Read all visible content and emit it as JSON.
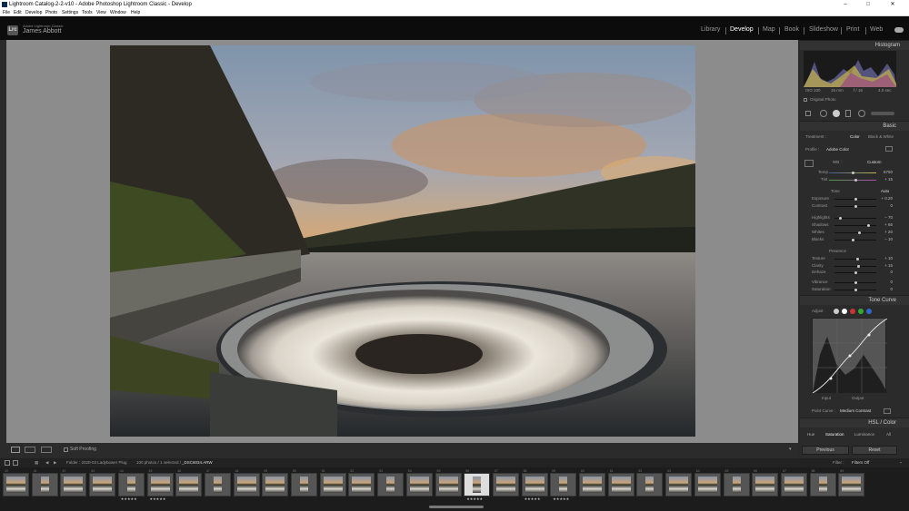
{
  "window": {
    "title": "Lightroom Catalog-2-2-v10 - Adobe Photoshop Lightroom Classic - Develop",
    "min": "–",
    "max": "□",
    "close": "✕"
  },
  "menu": [
    "File",
    "Edit",
    "Develop",
    "Photo",
    "Settings",
    "Tools",
    "View",
    "Window",
    "Help"
  ],
  "identity": {
    "logo": "Lrc",
    "subtitle": "Adobe Lightroom Classic",
    "user": "James Abbott"
  },
  "modules": [
    "Library",
    "Develop",
    "Map",
    "Book",
    "Slideshow",
    "Print",
    "Web"
  ],
  "active_module": "Develop",
  "histogram": {
    "title": "Histogram",
    "iso": "ISO 100",
    "focal": "16 mm",
    "aperture": "f / 16",
    "shutter": "4.0 sec",
    "original_photo": "Original Photo"
  },
  "basic": {
    "title": "Basic",
    "treatment_label": "Treatment :",
    "color": "Color",
    "bw": "Black & White",
    "profile_label": "Profile :",
    "profile": "Adobe Color",
    "wb_label": "WB :",
    "wb": "Custom",
    "temp_label": "Temp",
    "temp": "6750",
    "tint_label": "Tint",
    "tint": "+ 15",
    "tone_label": "Tone",
    "auto": "Auto",
    "sliders": [
      {
        "label": "Exposure",
        "value": "+ 0.20",
        "pos": 0.52
      },
      {
        "label": "Contrast",
        "value": "0",
        "pos": 0.5
      },
      {
        "label": "Highlights",
        "value": "– 70",
        "pos": 0.15
      },
      {
        "label": "Shadows",
        "value": "+ 65",
        "pos": 0.82
      },
      {
        "label": "Whites",
        "value": "+ 20",
        "pos": 0.6
      },
      {
        "label": "Blacks",
        "value": "– 10",
        "pos": 0.45
      }
    ],
    "presence_label": "Presence",
    "presence": [
      {
        "label": "Texture",
        "value": "+ 10",
        "pos": 0.55
      },
      {
        "label": "Clarity",
        "value": "+ 15",
        "pos": 0.57
      },
      {
        "label": "Dehaze",
        "value": "0",
        "pos": 0.5
      },
      {
        "label": "Vibrance",
        "value": "0",
        "pos": 0.5
      },
      {
        "label": "Saturation",
        "value": "0",
        "pos": 0.5
      }
    ]
  },
  "tone_curve": {
    "title": "Tone Curve",
    "adjust": "Adjust",
    "input": "Input",
    "output": "Output",
    "point_curve_label": "Point Curve :",
    "point_curve": "Medium Contrast"
  },
  "hsl": {
    "title": "HSL / Color",
    "tabs": [
      "Hue",
      "Saturation",
      "Luminance",
      "All"
    ]
  },
  "buttons": {
    "previous": "Previous",
    "reset": "Reset"
  },
  "toolbar": {
    "soft_proofing": "Soft Proofing"
  },
  "filmbar": {
    "folder": "Folder : 2020-03 Ladybower Plug",
    "count": "100 photos / 1 selected /",
    "file": "_DSC6034.ARW",
    "filter_label": "Filter :",
    "filter": "Filters Off"
  },
  "thumbnails": [
    {
      "n": "40",
      "stars": ""
    },
    {
      "n": "41",
      "stars": ""
    },
    {
      "n": "42",
      "stars": ""
    },
    {
      "n": "43",
      "stars": ""
    },
    {
      "n": "44",
      "stars": "★★★★★"
    },
    {
      "n": "45",
      "stars": "★★★★★"
    },
    {
      "n": "46",
      "stars": ""
    },
    {
      "n": "47",
      "stars": ""
    },
    {
      "n": "48",
      "stars": ""
    },
    {
      "n": "49",
      "stars": ""
    },
    {
      "n": "50",
      "stars": ""
    },
    {
      "n": "51",
      "stars": ""
    },
    {
      "n": "52",
      "stars": ""
    },
    {
      "n": "53",
      "stars": ""
    },
    {
      "n": "54",
      "stars": ""
    },
    {
      "n": "55",
      "stars": ""
    },
    {
      "n": "56",
      "stars": "★★★★★"
    },
    {
      "n": "57",
      "stars": ""
    },
    {
      "n": "58",
      "stars": "★★★★★"
    },
    {
      "n": "59",
      "stars": "★★★★★"
    },
    {
      "n": "60",
      "stars": ""
    },
    {
      "n": "61",
      "stars": ""
    },
    {
      "n": "62",
      "stars": ""
    },
    {
      "n": "63",
      "stars": ""
    },
    {
      "n": "64",
      "stars": ""
    },
    {
      "n": "65",
      "stars": ""
    },
    {
      "n": "66",
      "stars": ""
    },
    {
      "n": "67",
      "stars": ""
    },
    {
      "n": "68",
      "stars": ""
    },
    {
      "n": "69",
      "stars": ""
    }
  ],
  "selected_thumb": 16
}
